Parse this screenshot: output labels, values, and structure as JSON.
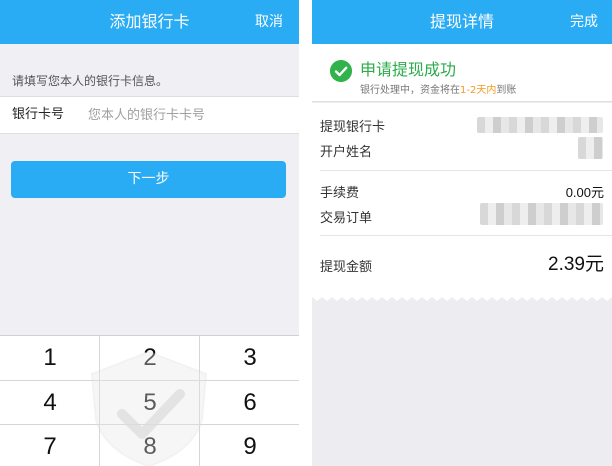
{
  "left": {
    "header": {
      "title": "添加银行卡",
      "cancel_label": "取消"
    },
    "hint": "请填写您本人的银行卡信息。",
    "card_field": {
      "label": "银行卡号",
      "placeholder": "您本人的银行卡卡号",
      "value": ""
    },
    "next_label": "下一步",
    "keypad": {
      "keys": [
        "1",
        "2",
        "3",
        "4",
        "5",
        "6",
        "7",
        "8",
        "9"
      ]
    },
    "icon": "shield-check-icon"
  },
  "right": {
    "header": {
      "title": "提现详情",
      "done_label": "完成"
    },
    "status": {
      "title": "申请提现成功",
      "sub_prefix": "银行处理中，资金将在",
      "sub_highlight": "1-2天内",
      "sub_suffix": "到账",
      "icon": "check-circle-icon"
    },
    "details": {
      "bank_card_label": "提现银行卡",
      "holder_label": "开户姓名",
      "fee_label": "手续费",
      "fee_value": "0.00元",
      "order_label": "交易订单",
      "amount_label": "提现金额",
      "amount_value": "2.39元"
    }
  },
  "colors": {
    "accent": "#2aacf5",
    "success": "#2bab4a",
    "highlight": "#f39a1e",
    "background": "#efeff4"
  }
}
